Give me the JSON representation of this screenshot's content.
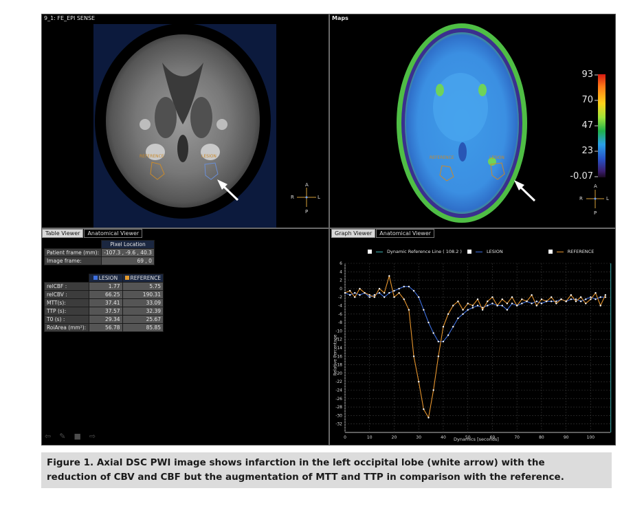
{
  "left_top": {
    "title": "9_1: FE_EPI SENSE",
    "roi_reference": "REFERENCE",
    "roi_lesion": "LESION",
    "orientation": {
      "a": "A",
      "p": "P",
      "r": "R",
      "l": "L"
    }
  },
  "right_top": {
    "title": "Maps",
    "roi_reference": "REFERENCE",
    "roi_lesion": "LESION",
    "colorbar_ticks": [
      "93",
      "70",
      "47",
      "23",
      "-0.07"
    ],
    "orientation": {
      "a": "A",
      "p": "P",
      "r": "R",
      "l": "L"
    }
  },
  "table_viewer": {
    "tabs": [
      "Table Viewer",
      "Anatomical Viewer"
    ],
    "pixel_header": "Pixel Location",
    "patient_frame_label": "Patient frame (mm):",
    "patient_frame_value": "-107.3 , -9.6 , 40.3",
    "image_frame_label": "Image frame:",
    "image_frame_value": "69 , 0",
    "col_lesion": "LESION",
    "col_reference": "REFERENCE",
    "lesion_color": "#3d6fe0",
    "reference_color": "#e39a2d",
    "rows": [
      {
        "label": "relCBF :",
        "lesion": "1.77",
        "reference": "5.75"
      },
      {
        "label": "relCBV :",
        "lesion": "66.25",
        "reference": "190.31"
      },
      {
        "label": "MTT(s):",
        "lesion": "37.41",
        "reference": "33.09"
      },
      {
        "label": "TTP (s):",
        "lesion": "37.57",
        "reference": "32.39"
      },
      {
        "label": "T0 (s) :",
        "lesion": "29.34",
        "reference": "25.67"
      },
      {
        "label": "RoiArea (mm²):",
        "lesion": "56.78",
        "reference": "85.85"
      }
    ]
  },
  "graph_viewer": {
    "tabs": [
      "Graph Viewer",
      "Anatomical Viewer"
    ],
    "legend_dynamic": "Dynamic Reference Line ( 108.2 )",
    "legend_lesion": "LESION",
    "legend_reference": "REFERENCE"
  },
  "chart_data": {
    "type": "line",
    "xlabel": "Dynamics [seconds]",
    "ylabel": "Relative Percentage",
    "xlim": [
      0,
      108
    ],
    "ylim": [
      -34,
      6
    ],
    "x_ticks": [
      0,
      10,
      20,
      30,
      40,
      50,
      60,
      70,
      80,
      90,
      100
    ],
    "y_ticks": [
      6,
      4,
      2,
      0,
      -2,
      -4,
      -6,
      -8,
      -10,
      -12,
      -14,
      -16,
      -18,
      -20,
      -22,
      -24,
      -26,
      -28,
      -30,
      -32
    ],
    "grid": true,
    "legend_position": "top",
    "dynamic_reference_x": 108.2,
    "series": [
      {
        "name": "LESION",
        "color": "#3d6fe0",
        "x": [
          0,
          2,
          4,
          6,
          8,
          10,
          12,
          14,
          16,
          18,
          20,
          22,
          24,
          26,
          28,
          30,
          32,
          34,
          36,
          38,
          40,
          42,
          44,
          46,
          48,
          50,
          52,
          54,
          56,
          58,
          60,
          62,
          64,
          66,
          68,
          70,
          72,
          74,
          76,
          78,
          80,
          82,
          84,
          86,
          88,
          90,
          92,
          94,
          96,
          98,
          100,
          102,
          104,
          106
        ],
        "y": [
          -1,
          -1.5,
          -1,
          -1.5,
          -1,
          -2,
          -1.5,
          -1,
          -2,
          -1,
          -0.5,
          0,
          0.5,
          0.5,
          -0.5,
          -2,
          -5,
          -8,
          -10.5,
          -12.5,
          -12.5,
          -11,
          -9,
          -7,
          -6,
          -5,
          -4.5,
          -4,
          -4.5,
          -4,
          -3.5,
          -4,
          -4,
          -5,
          -3.5,
          -4,
          -3.5,
          -3,
          -3.5,
          -3,
          -3.5,
          -3,
          -3,
          -3,
          -2.5,
          -3,
          -2.5,
          -2.5,
          -3,
          -2.5,
          -2,
          -2.5,
          -2,
          -2
        ]
      },
      {
        "name": "REFERENCE",
        "color": "#e8962e",
        "x": [
          0,
          2,
          4,
          6,
          8,
          10,
          12,
          14,
          16,
          18,
          20,
          22,
          24,
          26,
          28,
          30,
          32,
          34,
          36,
          38,
          40,
          42,
          44,
          46,
          48,
          50,
          52,
          54,
          56,
          58,
          60,
          62,
          64,
          66,
          68,
          70,
          72,
          74,
          76,
          78,
          80,
          82,
          84,
          86,
          88,
          90,
          92,
          94,
          96,
          98,
          100,
          102,
          104,
          106
        ],
        "y": [
          -1,
          -0.5,
          -2,
          0,
          -1,
          -1.5,
          -2,
          0,
          -1,
          3,
          -2,
          -1,
          -2.5,
          -5,
          -16,
          -22,
          -28.5,
          -30.5,
          -24,
          -16,
          -9,
          -6,
          -4,
          -3,
          -5,
          -3.5,
          -4,
          -2.5,
          -5,
          -3,
          -2,
          -4,
          -2.5,
          -3.5,
          -2,
          -4,
          -2.5,
          -3,
          -1.5,
          -4,
          -2.5,
          -3,
          -2,
          -3.5,
          -2.5,
          -3,
          -1.5,
          -3,
          -2,
          -3.5,
          -2.5,
          -1,
          -4,
          -1.5
        ]
      }
    ]
  },
  "caption": {
    "line1": "Figure 1. Axial DSC PWI image shows infarction in the left occipital lobe (white arrow) with the",
    "line2": "reduction of CBV and CBF but the augmentation of MTT and TTP in comparison with the reference."
  }
}
